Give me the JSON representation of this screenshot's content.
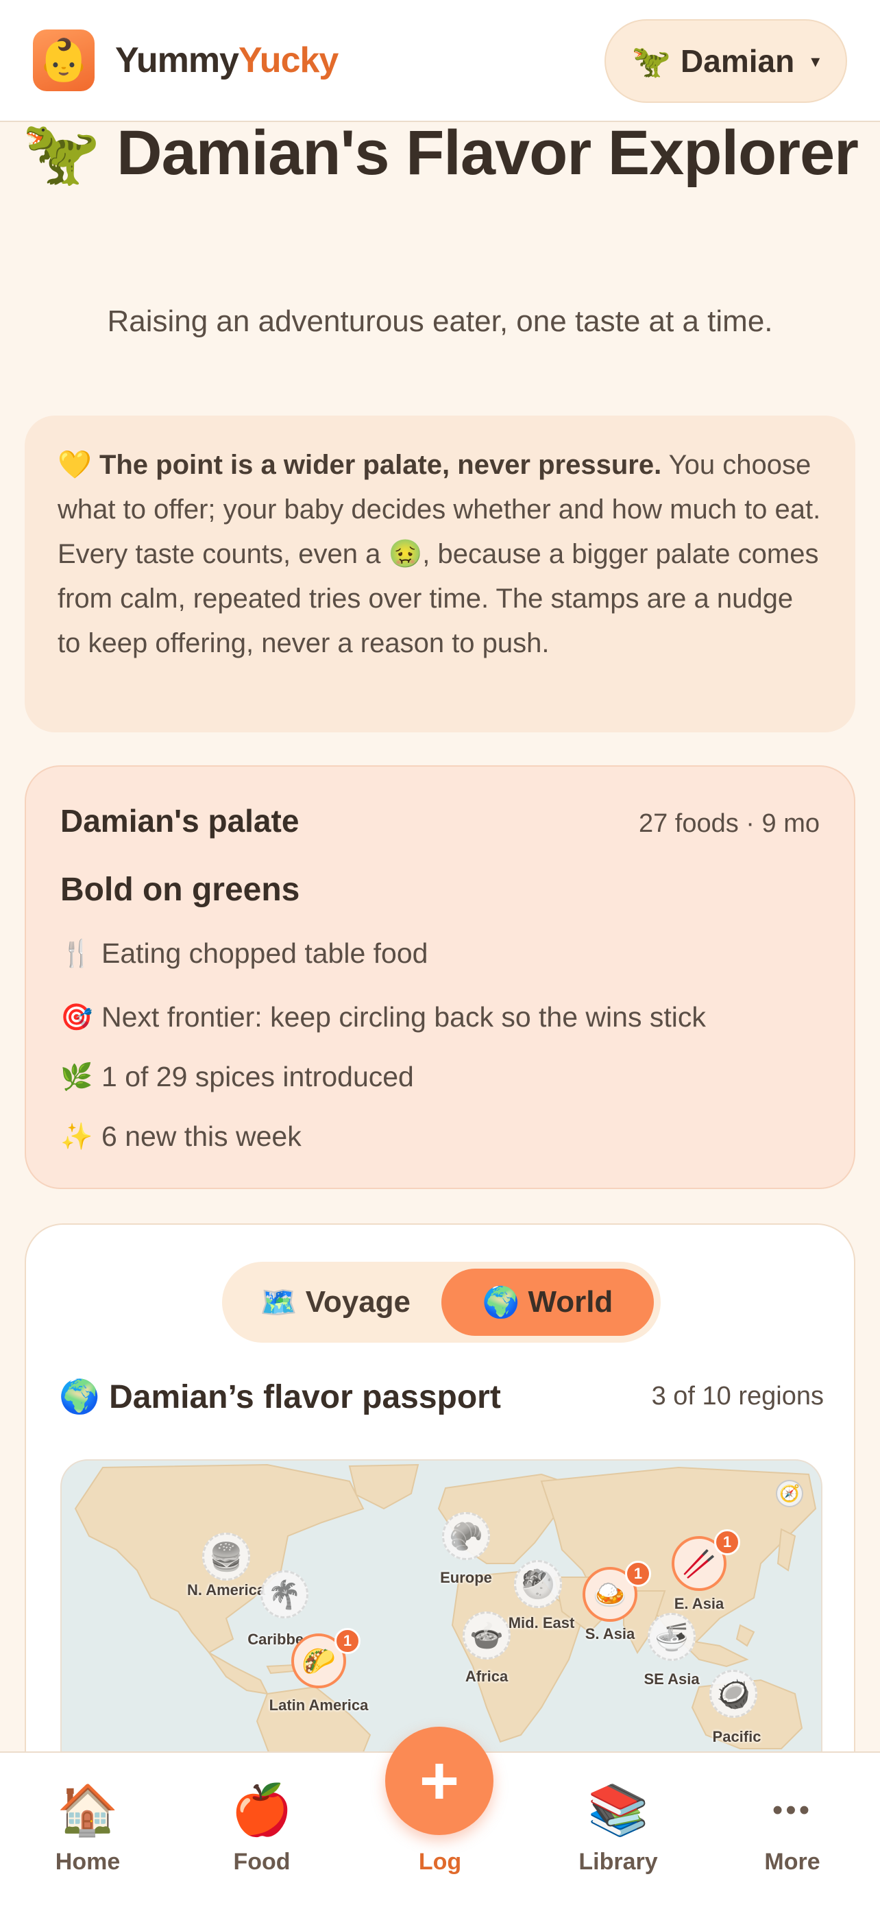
{
  "header": {
    "logo_icon": "baby-face-icon",
    "logo_glyph": "👶",
    "brand_part1": "Yummy",
    "brand_part2": "Yucky",
    "child_emoji": "🦖",
    "child_name": "Damian",
    "child_caret": "▾"
  },
  "hero": {
    "title": "🦖 Damian's Flavor Explorer",
    "subtitle": "Raising an adventurous eater, one taste at a time."
  },
  "note": {
    "emoji": "💛",
    "bold": "The point is a wider palate, never pressure.",
    "text_before_emoji": " You choose what to offer; your baby decides whether and how much to eat. Every taste counts, even a ",
    "inline_emoji": "🤢",
    "text_after_emoji": ", because a bigger palate comes from calm, repeated tries over time. The stamps are a nudge to keep offering, never a reason to push."
  },
  "palate": {
    "title": "Damian's palate",
    "meta": "27 foods · 9 mo",
    "trait": "Bold on greens",
    "lines": [
      {
        "emoji": "🍴",
        "icon": "fork-knife-icon",
        "text": "Eating chopped table food"
      },
      {
        "emoji": "🎯",
        "icon": "target-icon",
        "text": "Next frontier: keep circling back so the wins stick"
      },
      {
        "emoji": "🌿",
        "icon": "herb-icon",
        "text": "1 of 29 spices introduced"
      },
      {
        "emoji": "✨",
        "icon": "sparkles-icon",
        "text": "6 new this week"
      }
    ]
  },
  "passport": {
    "toggle": [
      {
        "emoji": "🗺️",
        "label": "Voyage",
        "active": false
      },
      {
        "emoji": "🌍",
        "label": "World",
        "active": true
      }
    ],
    "title": "🌍 Damian’s flavor passport",
    "count": "3 of 10 regions",
    "compass": "🧭",
    "regions": [
      {
        "name": "N. America",
        "emoji": "🍔",
        "unlocked": false,
        "count": ""
      },
      {
        "name": "Caribbean",
        "emoji": "🌴",
        "unlocked": false,
        "count": ""
      },
      {
        "name": "Latin America",
        "emoji": "🌮",
        "unlocked": true,
        "count": "1"
      },
      {
        "name": "Europe",
        "emoji": "🥐",
        "unlocked": false,
        "count": ""
      },
      {
        "name": "Africa",
        "emoji": "🍲",
        "unlocked": false,
        "count": ""
      },
      {
        "name": "Mid. East",
        "emoji": "🥙",
        "unlocked": false,
        "count": ""
      },
      {
        "name": "S. Asia",
        "emoji": "🍛",
        "unlocked": true,
        "count": "1"
      },
      {
        "name": "E. Asia",
        "emoji": "🥢",
        "unlocked": true,
        "count": "1"
      },
      {
        "name": "SE Asia",
        "emoji": "🍜",
        "unlocked": false,
        "count": ""
      },
      {
        "name": "Pacific",
        "emoji": "🥥",
        "unlocked": false,
        "count": ""
      }
    ],
    "colors": {
      "land": "#efdcbc",
      "sea": "#e3ecec",
      "accent": "#fb8a54"
    }
  },
  "nav": {
    "home": {
      "emoji": "🏠",
      "label": "Home"
    },
    "food": {
      "emoji": "🍎",
      "label": "Food"
    },
    "log": {
      "symbol": "+",
      "label": "Log"
    },
    "library": {
      "emoji": "📚",
      "label": "Library"
    },
    "more": {
      "symbol": "•••",
      "label": "More"
    }
  }
}
